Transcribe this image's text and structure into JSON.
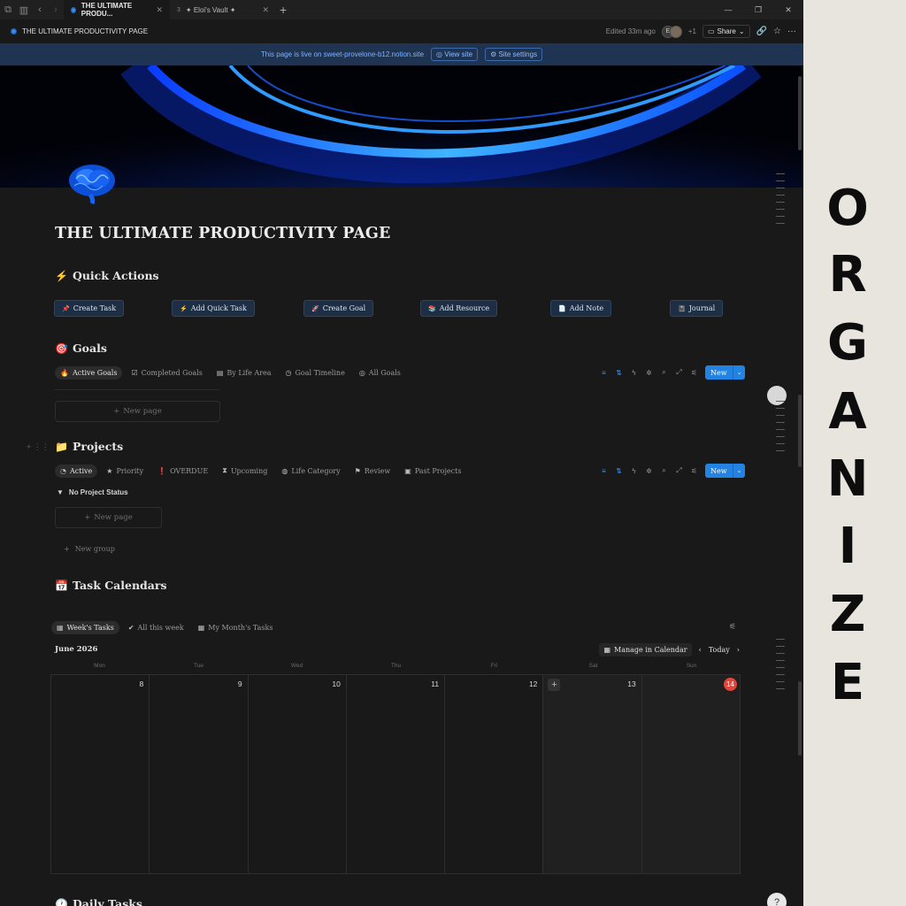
{
  "tabs": [
    {
      "label": "THE ULTIMATE PRODU...",
      "close": "✕"
    },
    {
      "label": "✦ Eloi's Vault ✦",
      "close": "✕"
    }
  ],
  "topbar": {
    "page_title": "THE ULTIMATE PRODUCTIVITY PAGE",
    "edited": "Edited 33m ago",
    "avatar_initial": "E",
    "extra_collaborators": "+1",
    "share_label": "Share"
  },
  "banner": {
    "text": "This page is live on sweet-provelone-b12.notion.site",
    "view_site": "View site",
    "site_settings": "Site settings"
  },
  "page": {
    "title": "THE ULTIMATE PRODUCTIVITY PAGE"
  },
  "quick_actions": {
    "heading": "Quick Actions",
    "emoji": "⚡",
    "buttons": [
      {
        "icon": "📌",
        "label": "Create Task"
      },
      {
        "icon": "⚡",
        "label": "Add Quick Task"
      },
      {
        "icon": "🚀",
        "label": "Create Goal"
      },
      {
        "icon": "📚",
        "label": "Add Resource"
      },
      {
        "icon": "📄",
        "label": "Add Note"
      },
      {
        "icon": "📓",
        "label": "Journal"
      }
    ]
  },
  "goals": {
    "heading": "Goals",
    "emoji": "🎯",
    "views": [
      "Active Goals",
      "Completed Goals",
      "By Life Area",
      "Goal Timeline",
      "All Goals"
    ],
    "new_label": "New",
    "new_page": "New page"
  },
  "projects": {
    "heading": "Projects",
    "emoji": "📁",
    "views": [
      "Active",
      "Priority",
      "OVERDUE",
      "Upcoming",
      "Life Category",
      "Review",
      "Past Projects"
    ],
    "group_label": "No Project Status",
    "new_label": "New",
    "new_page": "New page",
    "new_group": "New group"
  },
  "task_calendars": {
    "heading": "Task Calendars",
    "emoji": "📅",
    "views": [
      "Week's Tasks",
      "All this week",
      "My Month's Tasks"
    ],
    "month": "June 2026",
    "manage": "Manage in Calendar",
    "today": "Today",
    "weekdays": [
      "Mon",
      "Tue",
      "Wed",
      "Thu",
      "Fri",
      "Sat",
      "Sun"
    ],
    "days": [
      "8",
      "9",
      "10",
      "11",
      "12",
      "13",
      "14"
    ],
    "today_day": "14"
  },
  "daily_tasks": {
    "heading": "Daily Tasks",
    "emoji": "🕐"
  },
  "side_poster": {
    "letters": [
      "O",
      "R",
      "G",
      "A",
      "N",
      "I",
      "Z",
      "E"
    ]
  },
  "colors": {
    "accent": "#2383e2",
    "banner_bg": "#1f3452",
    "today": "#e0453a",
    "poster_bg": "#e8e4de"
  }
}
